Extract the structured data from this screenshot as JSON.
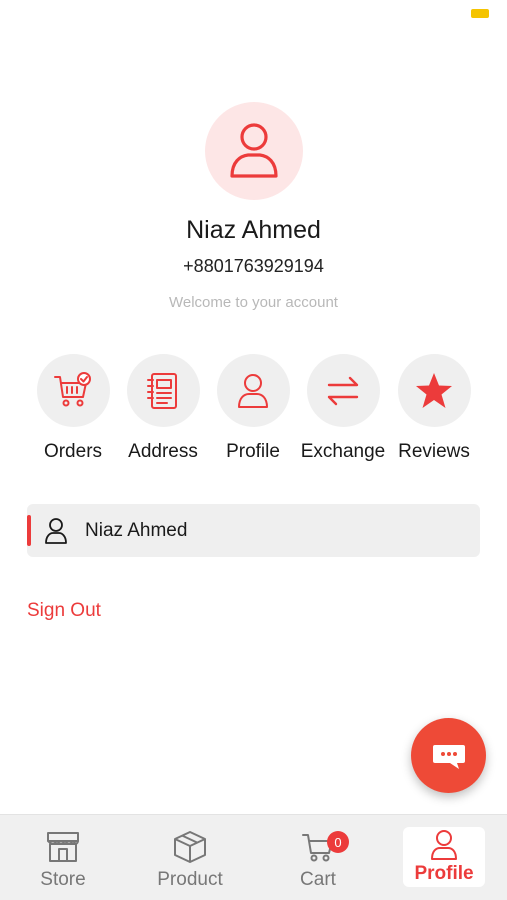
{
  "profile": {
    "name": "Niaz Ahmed",
    "phone": "+8801763929194",
    "welcome": "Welcome to your account"
  },
  "actions": [
    {
      "label": "Orders",
      "icon": "cart-check-icon"
    },
    {
      "label": "Address",
      "icon": "address-book-icon"
    },
    {
      "label": "Profile",
      "icon": "user-icon"
    },
    {
      "label": "Exchange",
      "icon": "exchange-arrows-icon"
    },
    {
      "label": "Reviews",
      "icon": "star-icon"
    }
  ],
  "account_row": {
    "name": "Niaz Ahmed",
    "icon": "user-icon"
  },
  "sign_out": "Sign Out",
  "fab": {
    "icon": "chat-icon"
  },
  "tabbar": {
    "tabs": [
      {
        "label": "Store",
        "icon": "store-icon",
        "active": false
      },
      {
        "label": "Product",
        "icon": "box-icon",
        "active": false
      },
      {
        "label": "Cart",
        "icon": "cart-icon",
        "active": false,
        "badge": "0"
      },
      {
        "label": "Profile",
        "icon": "user-icon",
        "active": true
      }
    ]
  },
  "colors": {
    "accent": "#ec3b3b",
    "accent_light": "#fde6e6",
    "fab": "#ee4a37",
    "muted": "#b8b8b8"
  }
}
